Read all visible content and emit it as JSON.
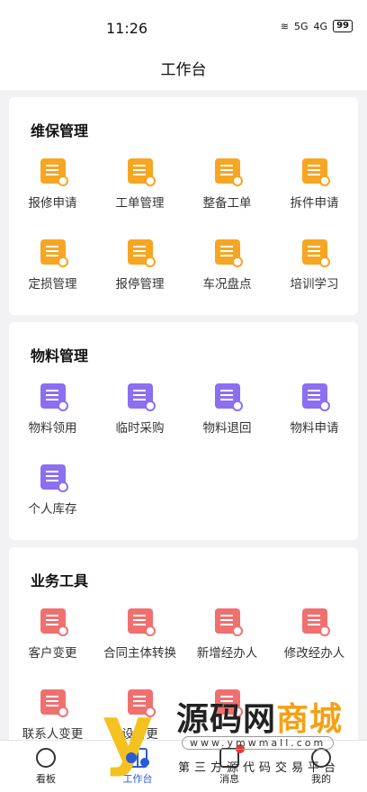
{
  "status": {
    "time": "11:26",
    "signal1": "5G",
    "signal2": "4G",
    "battery": "99"
  },
  "header": {
    "title": "工作台"
  },
  "sections": [
    {
      "title": "维保管理",
      "color": "#f6a623",
      "items": [
        {
          "label": "报修申请",
          "icon": "repair-request-icon"
        },
        {
          "label": "工单管理",
          "icon": "work-order-icon"
        },
        {
          "label": "整备工单",
          "icon": "prep-order-icon"
        },
        {
          "label": "拆件申请",
          "icon": "disassembly-icon"
        },
        {
          "label": "定损管理",
          "icon": "damage-assess-icon"
        },
        {
          "label": "报停管理",
          "icon": "suspend-icon"
        },
        {
          "label": "车况盘点",
          "icon": "vehicle-check-icon"
        },
        {
          "label": "培训学习",
          "icon": "training-icon"
        }
      ]
    },
    {
      "title": "物料管理",
      "color": "#8b6ff0",
      "items": [
        {
          "label": "物料领用",
          "icon": "material-receive-icon"
        },
        {
          "label": "临时采购",
          "icon": "temp-purchase-icon"
        },
        {
          "label": "物料退回",
          "icon": "material-return-icon"
        },
        {
          "label": "物料申请",
          "icon": "material-apply-icon"
        },
        {
          "label": "个人库存",
          "icon": "personal-stock-icon"
        }
      ]
    },
    {
      "title": "业务工具",
      "color": "#f07070",
      "items": [
        {
          "label": "客户变更",
          "icon": "customer-change-icon"
        },
        {
          "label": "合同主体转换",
          "icon": "contract-transfer-icon"
        },
        {
          "label": "新增经办人",
          "icon": "add-agent-icon"
        },
        {
          "label": "修改经办人",
          "icon": "edit-agent-icon"
        },
        {
          "label": "联系人变更",
          "icon": "contact-change-icon"
        },
        {
          "label": "设备更",
          "icon": "device-change-icon"
        },
        {
          "label": "",
          "icon": "document-edit-icon"
        }
      ]
    }
  ],
  "tabs": [
    {
      "label": "看板",
      "icon": "dashboard-icon"
    },
    {
      "label": "工作台",
      "icon": "workbench-icon",
      "active": true
    },
    {
      "label": "消息",
      "icon": "message-icon",
      "badge": true
    },
    {
      "label": "我的",
      "icon": "profile-icon"
    }
  ],
  "watermark": {
    "title_a": "源码网",
    "title_b": "商城",
    "url": "www.ymwmall.com",
    "subtitle": "第三方源代码交易平台"
  }
}
